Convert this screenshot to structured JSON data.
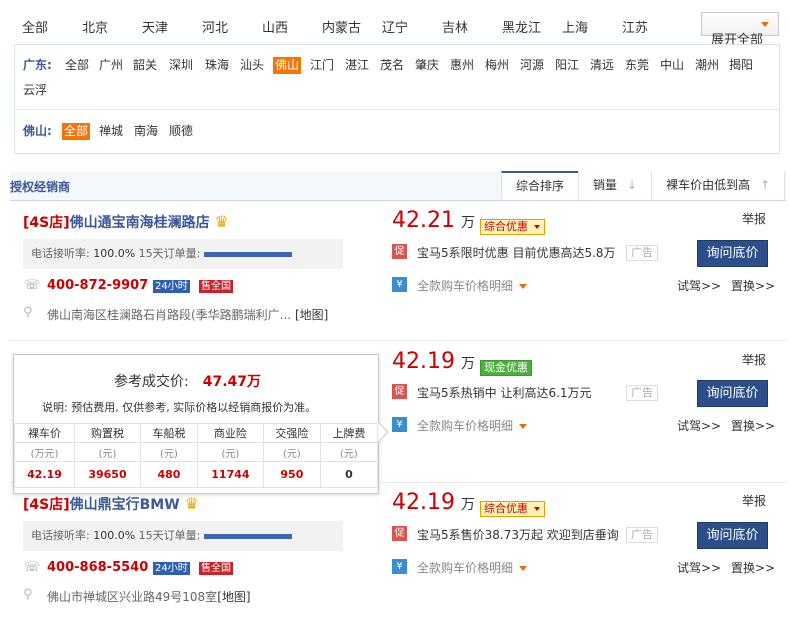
{
  "provinces": [
    "全部",
    "北京",
    "天津",
    "河北",
    "山西",
    "内蒙古",
    "辽宁",
    "吉林",
    "黑龙江",
    "上海",
    "江苏"
  ],
  "expand_label": "展开全部",
  "guangdong": {
    "label": "广东:",
    "cities": [
      "全部",
      "广州",
      "韶关",
      "深圳",
      "珠海",
      "汕头",
      "佛山",
      "江门",
      "湛江",
      "茂名",
      "肇庆",
      "惠州",
      "梅州",
      "河源",
      "阳江",
      "清远",
      "东莞",
      "中山",
      "潮州",
      "揭阳",
      "云浮"
    ],
    "selected": "佛山"
  },
  "foshan": {
    "label": "佛山:",
    "districts": [
      "全部",
      "禅城",
      "南海",
      "顺德"
    ],
    "selected": "全部"
  },
  "tabs": {
    "authorized": "授权经销商",
    "sort_default": "综合排序",
    "sort_sales": "销量",
    "sort_price": "裸车价由低到高"
  },
  "common": {
    "rate_label": "电话接听率:",
    "order_label": "15天订单量:",
    "hours": "24小时",
    "sell_scope": "售全国",
    "report": "举报",
    "ad_badge": "广告",
    "ask_price": "询问底价",
    "price_detail": "全款购车价格明细",
    "test_drive": "试驾>>",
    "trade_in": "置换>>",
    "map_link": "[地图]",
    "price_unit": "万",
    "promo_icon": "促",
    "yen_icon": "¥"
  },
  "dealers": [
    {
      "type": "[4S店]",
      "name": "佛山通宝南海桂澜路店",
      "rate": "100.0%",
      "phone": "400-872-9907",
      "address": "佛山南海区桂澜路石肖路段(季华路鹏瑞利广...",
      "price": "42.21",
      "promo": "综合优惠",
      "ad_text": "宝马5系限时优惠 目前优惠高达5.8万"
    },
    {
      "price": "42.19",
      "promo": "现金优惠",
      "ad_text": "宝马5系热销中 让利高达6.1万元"
    },
    {
      "type": "[4S店]",
      "name": "佛山鼎宝行BMW",
      "rate": "100.0%",
      "phone": "400-868-5540",
      "address": "佛山市禅城区兴业路49号108室",
      "price": "42.19",
      "promo": "综合优惠",
      "ad_text": "宝马5系售价38.73万起 欢迎到店垂询"
    }
  ],
  "popup": {
    "title": "参考成交价:",
    "value": "47.47万",
    "note": "说明: 预估费用, 仅供参考, 实际价格以经销商报价为准。",
    "headers": [
      "裸车价",
      "购置税",
      "车船税",
      "商业险",
      "交强险",
      "上牌费"
    ],
    "units": [
      "(万元)",
      "(元)",
      "(元)",
      "(元)",
      "(元)",
      "(元)"
    ],
    "values": [
      "42.19",
      "39650",
      "480",
      "11744",
      "950",
      "0"
    ]
  },
  "colors": {
    "accent_orange": "#f47407",
    "link_blue": "#3b5998",
    "price_red": "#cc0000",
    "button_blue": "#2c4f8c"
  }
}
